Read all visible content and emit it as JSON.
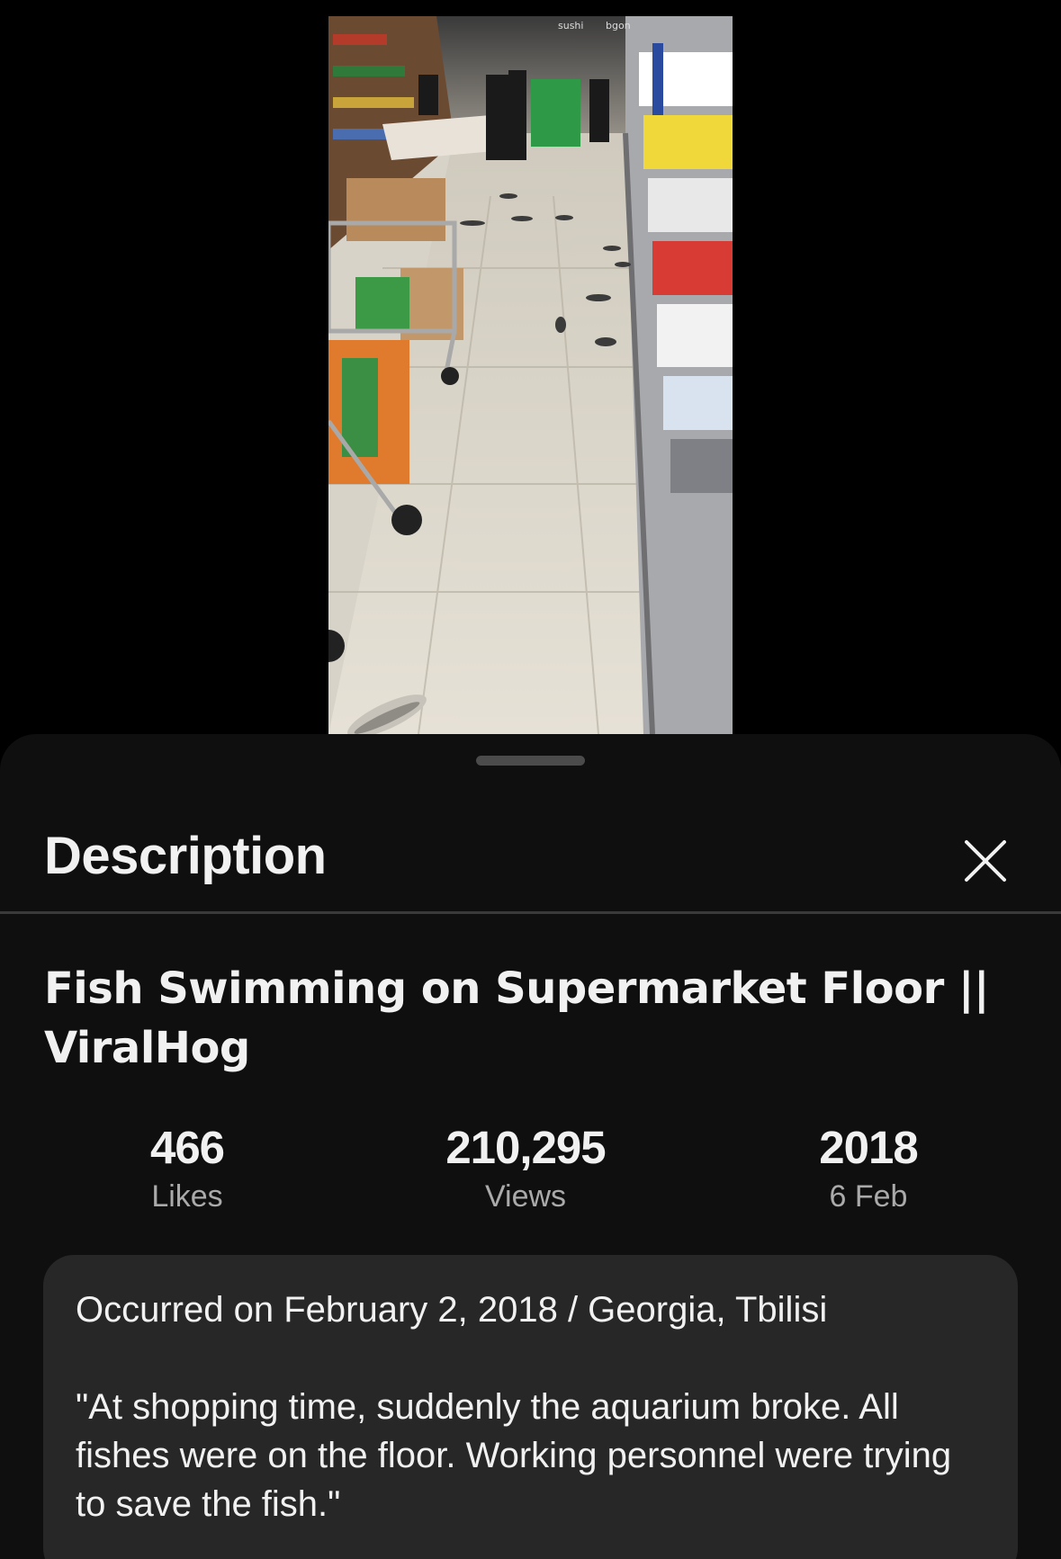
{
  "sheet": {
    "title": "Description",
    "close_icon": "close-icon"
  },
  "video": {
    "title": "Fish Swimming on Supermarket Floor || ViralHog",
    "sign_texts": [
      "sushi",
      "bgon"
    ]
  },
  "stats": {
    "likes": {
      "value": "466",
      "label": "Likes"
    },
    "views": {
      "value": "210,295",
      "label": "Views"
    },
    "date": {
      "value": "2018",
      "label": "6 Feb"
    }
  },
  "description": {
    "line1": "Occurred on February 2, 2018 / Georgia, Tbilisi",
    "line2": "\"At shopping time, suddenly the aquarium broke. All fishes were on the floor. Working personnel were trying to save the fish.\""
  },
  "colors": {
    "background": "#000000",
    "sheet": "#0f0f0f",
    "card": "#272727",
    "text_primary": "#f1f1f1",
    "text_secondary": "#aaaaaa"
  }
}
